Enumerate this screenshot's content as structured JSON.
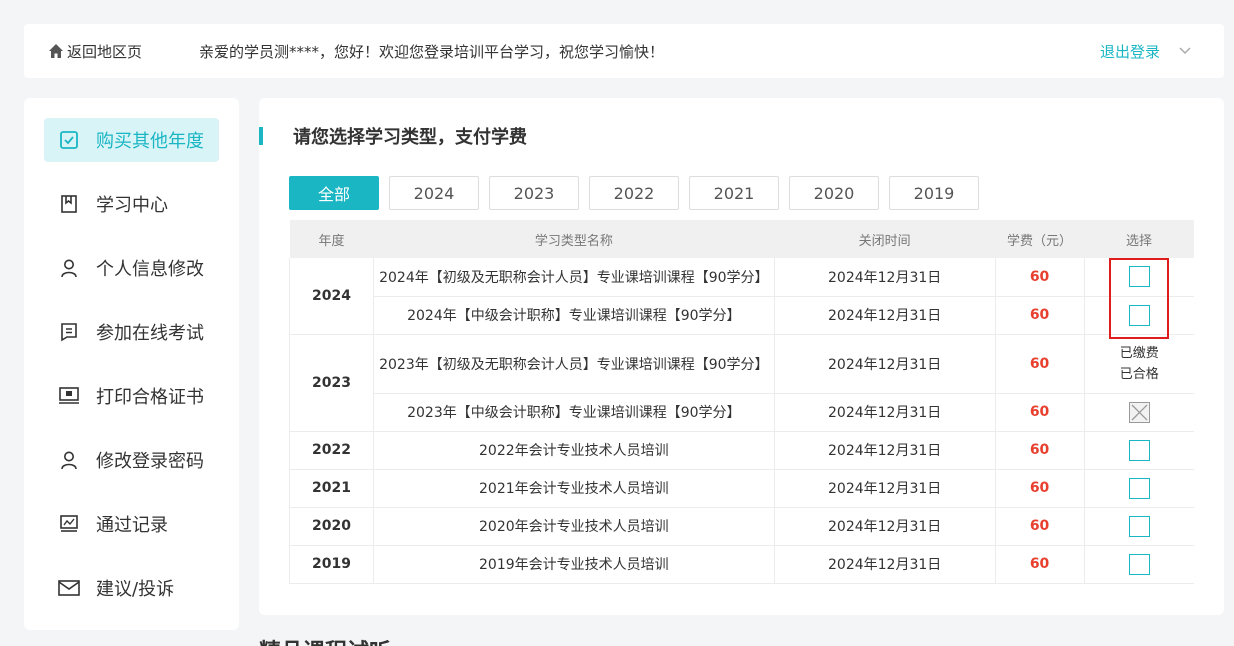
{
  "topbar": {
    "back_label": "返回地区页",
    "welcome": "亲爱的学员测****，您好！欢迎您登录培训平台学习，祝您学习愉快！",
    "logout": "退出登录"
  },
  "sidebar": {
    "items": [
      {
        "label": "购买其他年度",
        "icon": "checkbox-icon"
      },
      {
        "label": "学习中心",
        "icon": "bookmark-icon"
      },
      {
        "label": "个人信息修改",
        "icon": "user-icon"
      },
      {
        "label": "参加在线考试",
        "icon": "exam-icon"
      },
      {
        "label": "打印合格证书",
        "icon": "certificate-icon"
      },
      {
        "label": "修改登录密码",
        "icon": "user-icon"
      },
      {
        "label": "通过记录",
        "icon": "chart-icon"
      },
      {
        "label": "建议/投诉",
        "icon": "mail-icon"
      }
    ]
  },
  "main": {
    "title": "请您选择学习类型，支付学费",
    "year_tabs": [
      "全部",
      "2024",
      "2023",
      "2022",
      "2021",
      "2020",
      "2019"
    ],
    "table": {
      "headers": [
        "年度",
        "学习类型名称",
        "关闭时间",
        "学费（元）",
        "选择"
      ],
      "rows": [
        {
          "year": "2024",
          "name": "2024年【初级及无职称会计人员】专业课培训课程【90学分】",
          "close": "2024年12月31日",
          "fee": "60"
        },
        {
          "year": "",
          "name": "2024年【中级会计职称】专业课培训课程【90学分】",
          "close": "2024年12月31日",
          "fee": "60"
        },
        {
          "year": "2023",
          "name": "2023年【初级及无职称会计人员】专业课培训课程【90学分】",
          "close": "2024年12月31日",
          "fee": "60",
          "status1": "已缴费",
          "status2": "已合格"
        },
        {
          "year": "",
          "name": "2023年【中级会计职称】专业课培训课程【90学分】",
          "close": "2024年12月31日",
          "fee": "60"
        },
        {
          "year": "2022",
          "name": "2022年会计专业技术人员培训",
          "close": "2024年12月31日",
          "fee": "60"
        },
        {
          "year": "2021",
          "name": "2021年会计专业技术人员培训",
          "close": "2024年12月31日",
          "fee": "60"
        },
        {
          "year": "2020",
          "name": "2020年会计专业技术人员培训",
          "close": "2024年12月31日",
          "fee": "60"
        },
        {
          "year": "2019",
          "name": "2019年会计专业技术人员培训",
          "close": "2024年12月31日",
          "fee": "60"
        }
      ]
    }
  },
  "bottom_title": "精品课程试听",
  "colors": {
    "accent": "#1ab6c4",
    "fee": "#e8402f",
    "highlight": "#e01d1d"
  }
}
